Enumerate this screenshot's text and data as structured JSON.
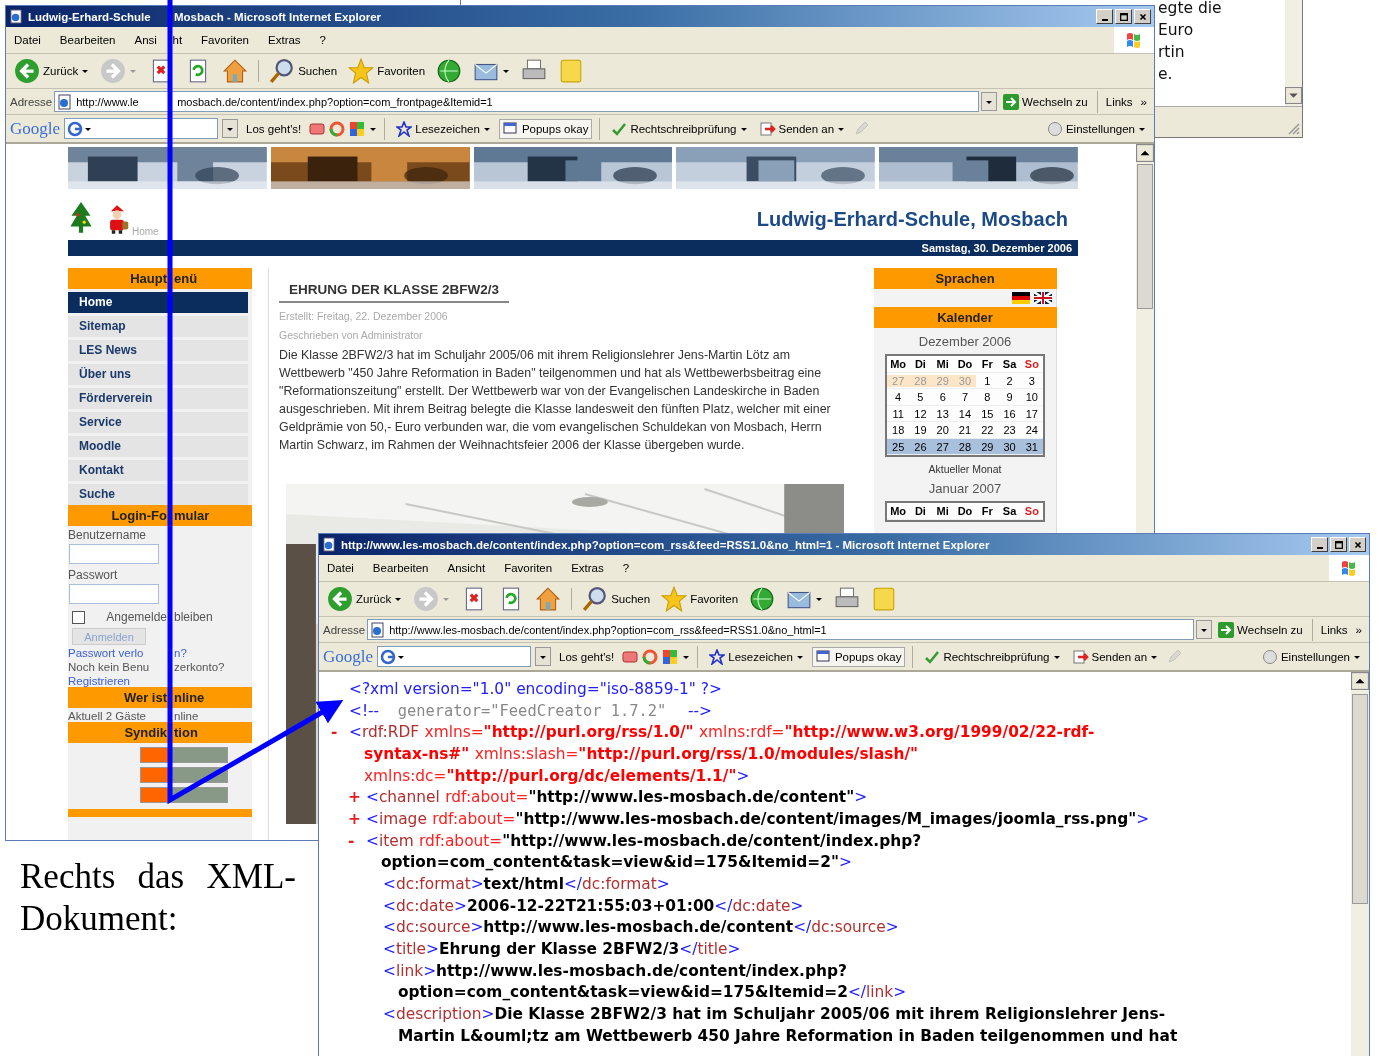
{
  "background_window": {
    "lines": [
      "egte die",
      "Euro",
      "rtin",
      "e."
    ]
  },
  "school_window": {
    "title": [
      "Ludwig-Erhard-Schule",
      "Mosbach - Microsoft Internet Explorer"
    ],
    "menu": [
      "Datei",
      "Bearbeiten",
      [
        "Ansi",
        "ht"
      ],
      "Favoriten",
      "Extras",
      "?"
    ],
    "toolbar": {
      "back": "Zurück",
      "search": "Suchen",
      "favorites": "Favoriten"
    },
    "address": {
      "label": "Adresse",
      "url": [
        "http://www.le",
        "mosbach.de/content/index.php?option=com_frontpage&Itemid=1"
      ],
      "go": "Wechseln zu",
      "links": "Links",
      "more": "»"
    },
    "google_bar": {
      "logo": "Google",
      "go": "Los geht's!",
      "bookmarks": "Lesezeichen",
      "popups": "Popups okay",
      "spell": "Rechtschreibprüfung",
      "send": "Senden an",
      "settings": "Einstellungen"
    },
    "page": {
      "breadcrumb": "Home",
      "site_title": "**L**udwig-**E**rhard-**S**chule, Mosbach",
      "date": "Samstag, 30. Dezember 2006",
      "main_menu": {
        "title": [
          "Haupt",
          "enü"
        ],
        "items": [
          {
            "label": "Home",
            "selected": true
          },
          {
            "label": "Sitemap",
            "selected": false
          },
          {
            "label": "LES News",
            "selected": false
          },
          {
            "label": "Über uns",
            "selected": false
          },
          {
            "label": "Förderverein",
            "selected": false
          },
          {
            "label": "Service",
            "selected": false
          },
          {
            "label": "Moodle",
            "selected": false
          },
          {
            "label": "Kontakt",
            "selected": false
          },
          {
            "label": "Suche",
            "selected": false
          }
        ]
      },
      "login": {
        "title": [
          "Login-Fo",
          "mular"
        ],
        "username_label": "Benutzername",
        "password_label": "Passwort",
        "remember": {
          "label": [
            "Angemelde",
            "bleiben"
          ],
          "checked": false
        },
        "button": {
          "label": "Anmelden",
          "disabled": true
        },
        "forgot": [
          "Passwort verlo",
          "n?"
        ],
        "no_account": [
          "Noch kein Benu",
          "zerkonto?"
        ],
        "register": "Registrieren"
      },
      "online": {
        "title": [
          "Wer ist",
          "nline"
        ],
        "text": [
          "Aktuell 2 Gäste",
          "nline"
        ]
      },
      "syndication": {
        "title": [
          "Syndik",
          "tion"
        ]
      },
      "article": {
        "title": "EHRUNG DER KLASSE 2BFW2/3",
        "created": "Erstellt: Freitag, 22. Dezember 2006",
        "author": "Geschrieben von Administrator",
        "body": "Die Klasse 2BFW2/3 hat im Schuljahr 2005/06 mit ihrem Religionslehrer Jens-Martin Lötz am Wettbewerb \"450 Jahre Reformation in Baden\" teilgenommen und hat als Wettbewerbsbeitrag eine \"Reformationszeitung\" erstellt. Der Wettbewerb war von der Evangelischen Landeskirche in Baden ausgeschrieben. Mit ihrem Beitrag belegte die Klasse landesweit den fünften Platz, welcher mit einer Geldprämie von 50,- Euro verbunden war, die vom evangelischen Schuldekan von Mosbach, Herrn Martin Schwarz, im Rahmen der Weihnachtsfeier 2006 der Klasse übergeben wurde."
      },
      "languages": {
        "title": "Sprachen"
      },
      "calendar": {
        "title": "Kalender",
        "month": "Dezember 2006",
        "weekdays": [
          {
            "label": "Mo",
            "kind": "weekday"
          },
          {
            "label": "Di",
            "kind": "weekday"
          },
          {
            "label": "Mi",
            "kind": "weekday"
          },
          {
            "label": "Do",
            "kind": "weekday"
          },
          {
            "label": "Fr",
            "kind": "weekday"
          },
          {
            "label": "Sa",
            "kind": "weekday"
          },
          {
            "label": "So",
            "kind": "sunday"
          }
        ],
        "weeks": [
          {
            "selected": false,
            "days": [
              {
                "day": "27",
                "kind": "other"
              },
              {
                "day": "28",
                "kind": "other"
              },
              {
                "day": "29",
                "kind": "other"
              },
              {
                "day": "30",
                "kind": "other"
              },
              {
                "day": "1",
                "kind": "month"
              },
              {
                "day": "2",
                "kind": "month"
              },
              {
                "day": "3",
                "kind": "month"
              }
            ]
          },
          {
            "selected": false,
            "days": [
              {
                "day": "4",
                "kind": "month"
              },
              {
                "day": "5",
                "kind": "month"
              },
              {
                "day": "6",
                "kind": "month"
              },
              {
                "day": "7",
                "kind": "month"
              },
              {
                "day": "8",
                "kind": "month"
              },
              {
                "day": "9",
                "kind": "month"
              },
              {
                "day": "10",
                "kind": "month"
              }
            ]
          },
          {
            "selected": false,
            "days": [
              {
                "day": "11",
                "kind": "month"
              },
              {
                "day": "12",
                "kind": "month"
              },
              {
                "day": "13",
                "kind": "month"
              },
              {
                "day": "14",
                "kind": "month"
              },
              {
                "day": "15",
                "kind": "month"
              },
              {
                "day": "16",
                "kind": "month"
              },
              {
                "day": "17",
                "kind": "month"
              }
            ]
          },
          {
            "selected": false,
            "days": [
              {
                "day": "18",
                "kind": "month"
              },
              {
                "day": "19",
                "kind": "month"
              },
              {
                "day": "20",
                "kind": "month"
              },
              {
                "day": "21",
                "kind": "month"
              },
              {
                "day": "22",
                "kind": "month"
              },
              {
                "day": "23",
                "kind": "month"
              },
              {
                "day": "24",
                "kind": "month"
              }
            ]
          },
          {
            "selected": true,
            "days": [
              {
                "day": "25",
                "kind": "month"
              },
              {
                "day": "26",
                "kind": "month"
              },
              {
                "day": "27",
                "kind": "month"
              },
              {
                "day": "28",
                "kind": "month"
              },
              {
                "day": "29",
                "kind": "month"
              },
              {
                "day": "30",
                "kind": "month"
              },
              {
                "day": "31",
                "kind": "month"
              }
            ]
          }
        ],
        "current_month": "Aktueller Monat",
        "next_month": {
          "title": "Januar 2007",
          "weekdays": [
            {
              "label": "Mo",
              "kind": "weekday"
            },
            {
              "label": "Di",
              "kind": "weekday"
            },
            {
              "label": "Mi",
              "kind": "weekday"
            },
            {
              "label": "Do",
              "kind": "weekday"
            },
            {
              "label": "Fr",
              "kind": "weekday"
            },
            {
              "label": "Sa",
              "kind": "weekday"
            },
            {
              "label": "So",
              "kind": "sunday"
            }
          ]
        }
      }
    }
  },
  "feed_window": {
    "title": [
      "http://www.les-mosbach.de/content/index.php?option=com_rss&feed=RSS1.0&no_html=1 - Microsoft Internet Explorer"
    ],
    "menu": [
      "Datei",
      "Bearbeiten",
      "Ansicht",
      "Favoriten",
      "Extras",
      "?"
    ],
    "toolbar": {
      "back": "Zurück",
      "search": "Suchen",
      "favorites": "Favoriten"
    },
    "address": {
      "label": "Adresse",
      "url": [
        "http://www.les-mosbach.de/content/index.php?option=com_rss&feed=RSS1.0&no_html=1"
      ],
      "go": "Wechseln zu",
      "links": "Links",
      "more": "»"
    },
    "google_bar": {
      "logo": "Google",
      "go": "Los geht's!",
      "bookmarks": "Lesezeichen",
      "popups": "Popups okay",
      "spell": "Rechtschreibprüfung",
      "send": "Senden an",
      "settings": "Einstellungen"
    },
    "xml": [
      {
        "lines": [
          [
            {
              "kind": "pi",
              "text": "<?xml version=\"1.0\" encoding=\"iso-8859-1\" ?>"
            }
          ]
        ]
      },
      {
        "lines": [
          [
            {
              "kind": "punct",
              "text": "<!--"
            },
            {
              "kind": "comment",
              "text": "generator=\"FeedCreator 1.7.2\""
            },
            {
              "kind": "punct",
              "text": "-->"
            }
          ]
        ]
      },
      {
        "toggle": "-",
        "lines": [
          [
            {
              "kind": "punct",
              "text": "<"
            },
            {
              "kind": "tag",
              "text": "rdf:RDF"
            },
            {
              "kind": "attr",
              "text": "xmlns="
            },
            {
              "kind": "nsval",
              "text": "\"http://purl.org/rss/1.0/\""
            },
            {
              "kind": "attr",
              "text": "xmlns:rdf="
            },
            {
              "kind": "nsval",
              "text": "\"http://www.w3.org/1999/02/22-rdf-"
            }
          ],
          [
            {
              "kind": "nsval",
              "text": "syntax-ns#\""
            },
            {
              "kind": "attr",
              "text": "xmlns:slash="
            },
            {
              "kind": "nsval",
              "text": "\"http://purl.org/rss/1.0/modules/slash/\""
            }
          ],
          [
            {
              "kind": "attr",
              "text": "xmlns:dc="
            },
            {
              "kind": "nsval",
              "text": "\"http://purl.org/dc/elements/1.1/\""
            },
            {
              "kind": "punct",
              "text": ">"
            }
          ]
        ],
        "children": [
          {
            "toggle": "+",
            "lines": [
              [
                {
                  "kind": "punct",
                  "text": "<"
                },
                {
                  "kind": "tag",
                  "text": "channel"
                },
                {
                  "kind": "attr",
                  "text": "rdf:about="
                },
                {
                  "kind": "value",
                  "text": "\"http://www.les-mosbach.de/content\""
                },
                {
                  "kind": "punct",
                  "text": ">"
                }
              ]
            ]
          },
          {
            "toggle": "+",
            "lines": [
              [
                {
                  "kind": "punct",
                  "text": "<"
                },
                {
                  "kind": "tag",
                  "text": "image"
                },
                {
                  "kind": "attr",
                  "text": "rdf:about="
                },
                {
                  "kind": "value",
                  "text": "\"http://www.les-mosbach.de/content/images/M_images/joomla_rss.png\""
                },
                {
                  "kind": "punct",
                  "text": ">"
                }
              ]
            ]
          },
          {
            "toggle": "-",
            "lines": [
              [
                {
                  "kind": "punct",
                  "text": "<"
                },
                {
                  "kind": "tag",
                  "text": "item"
                },
                {
                  "kind": "attr",
                  "text": "rdf:about="
                },
                {
                  "kind": "value",
                  "text": "\"http://www.les-mosbach.de/content/index.php?"
                }
              ],
              [
                {
                  "kind": "value",
                  "text": "option=com_content&task=view&id=175&Itemid=2\""
                },
                {
                  "kind": "punct",
                  "text": ">"
                }
              ]
            ],
            "children": [
              {
                "lines": [
                  [
                    {
                      "kind": "punct",
                      "text": "<"
                    },
                    {
                      "kind": "tag",
                      "text": "dc:format"
                    },
                    {
                      "kind": "punct",
                      "text": ">"
                    },
                    {
                      "kind": "text",
                      "text": "text/html"
                    },
                    {
                      "kind": "punct",
                      "text": "</"
                    },
                    {
                      "kind": "tag",
                      "text": "dc:format"
                    },
                    {
                      "kind": "punct",
                      "text": ">"
                    }
                  ]
                ]
              },
              {
                "lines": [
                  [
                    {
                      "kind": "punct",
                      "text": "<"
                    },
                    {
                      "kind": "tag",
                      "text": "dc:date"
                    },
                    {
                      "kind": "punct",
                      "text": ">"
                    },
                    {
                      "kind": "text",
                      "text": "2006-12-22T21:55:03+01:00"
                    },
                    {
                      "kind": "punct",
                      "text": "</"
                    },
                    {
                      "kind": "tag",
                      "text": "dc:date"
                    },
                    {
                      "kind": "punct",
                      "text": ">"
                    }
                  ]
                ]
              },
              {
                "lines": [
                  [
                    {
                      "kind": "punct",
                      "text": "<"
                    },
                    {
                      "kind": "tag",
                      "text": "dc:source"
                    },
                    {
                      "kind": "punct",
                      "text": ">"
                    },
                    {
                      "kind": "text",
                      "text": "http://www.les-mosbach.de/content"
                    },
                    {
                      "kind": "punct",
                      "text": "</"
                    },
                    {
                      "kind": "tag",
                      "text": "dc:source"
                    },
                    {
                      "kind": "punct",
                      "text": ">"
                    }
                  ]
                ]
              },
              {
                "lines": [
                  [
                    {
                      "kind": "punct",
                      "text": "<"
                    },
                    {
                      "kind": "tag",
                      "text": "title"
                    },
                    {
                      "kind": "punct",
                      "text": ">"
                    },
                    {
                      "kind": "text",
                      "text": "Ehrung der Klasse 2BFW2/3"
                    },
                    {
                      "kind": "punct",
                      "text": "</"
                    },
                    {
                      "kind": "tag",
                      "text": "title"
                    },
                    {
                      "kind": "punct",
                      "text": ">"
                    }
                  ]
                ]
              },
              {
                "lines": [
                  [
                    {
                      "kind": "punct",
                      "text": "<"
                    },
                    {
                      "kind": "tag",
                      "text": "link"
                    },
                    {
                      "kind": "punct",
                      "text": ">"
                    },
                    {
                      "kind": "text",
                      "text": "http://www.les-mosbach.de/content/index.php?"
                    }
                  ],
                  [
                    {
                      "kind": "text",
                      "text": "option=com_content&task=view&id=175&Itemid=2"
                    },
                    {
                      "kind": "punct",
                      "text": "</"
                    },
                    {
                      "kind": "tag",
                      "text": "link"
                    },
                    {
                      "kind": "punct",
                      "text": ">"
                    }
                  ]
                ]
              },
              {
                "lines": [
                  [
                    {
                      "kind": "punct",
                      "text": "<"
                    },
                    {
                      "kind": "tag",
                      "text": "description"
                    },
                    {
                      "kind": "punct",
                      "text": ">"
                    },
                    {
                      "kind": "text",
                      "text": "Die Klasse 2BFW2/3 hat im Schuljahr 2005/06 mit ihrem Religionslehrer Jens-"
                    }
                  ],
                  [
                    {
                      "kind": "text",
                      "text": "Martin L&ouml;tz am Wettbewerb 450 Jahre Reformation in Baden teilgenommen und hat"
                    }
                  ]
                ]
              }
            ]
          }
        ]
      }
    ]
  },
  "caption": "Rechts das XML-Dokument:"
}
